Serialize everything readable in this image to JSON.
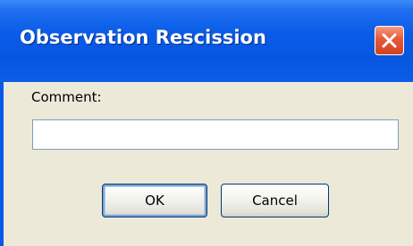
{
  "window": {
    "title": "Observation Rescission",
    "close_icon": "close-x-icon"
  },
  "form": {
    "comment_label": "Comment:",
    "comment_value": "",
    "comment_placeholder": ""
  },
  "buttons": {
    "ok_label": "OK",
    "cancel_label": "Cancel"
  },
  "colors": {
    "titlebar": "#0a59e6",
    "client_background": "#ece9d8",
    "close_button": "#e4593a",
    "input_border": "#7f9db9",
    "button_border": "#003c74"
  }
}
